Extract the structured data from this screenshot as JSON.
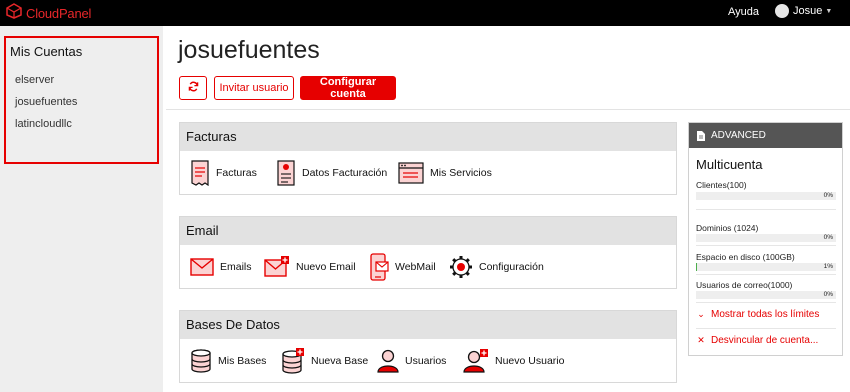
{
  "topbar": {
    "brand": "CloudPanel",
    "help_label": "Ayuda",
    "user_name": "Josue"
  },
  "sidebar": {
    "title": "Mis Cuentas",
    "accounts": [
      "elserver",
      "josuefuentes",
      "latincloudllc"
    ]
  },
  "main": {
    "title": "josuefuentes",
    "invite_label": "Invitar usuario",
    "config_label": "Configurar cuenta"
  },
  "panels": {
    "facturas": {
      "title": "Facturas",
      "items": [
        "Facturas",
        "Datos Facturación",
        "Mis Servicios"
      ]
    },
    "email": {
      "title": "Email",
      "items": [
        "Emails",
        "Nuevo Email",
        "WebMail",
        "Configuración"
      ]
    },
    "bases": {
      "title": "Bases De Datos",
      "items": [
        "Mis Bases",
        "Nueva Base",
        "Usuarios",
        "Nuevo Usuario"
      ]
    }
  },
  "advanced": {
    "header": "ADVANCED",
    "title": "Multicuenta",
    "limits": [
      {
        "label": "Clientes(100)",
        "percent": "0%",
        "fill": 0
      },
      {
        "label": "Dominios (1024)",
        "percent": "0%",
        "fill": 0
      },
      {
        "label": "Espacio en disco (100GB)",
        "percent": "1%",
        "fill": 1
      },
      {
        "label": "Usuarios de correo(1000)",
        "percent": "0%",
        "fill": 0
      }
    ],
    "show_limits": "Mostrar todas los límites",
    "unlink": "Desvincular de cuenta..."
  },
  "colors": {
    "accent": "#e60000",
    "topbar": "#000000",
    "sidebar": "#eeeeee",
    "panel_header": "#e2e2e2",
    "card_header": "#555555",
    "progress": "#4cae4c"
  },
  "icons": {
    "refresh": "refresh-icon",
    "user_caret": "chevron-down-icon",
    "advanced": "document-icon",
    "show_limits": "chevron-down-icon",
    "unlink": "close-icon"
  }
}
